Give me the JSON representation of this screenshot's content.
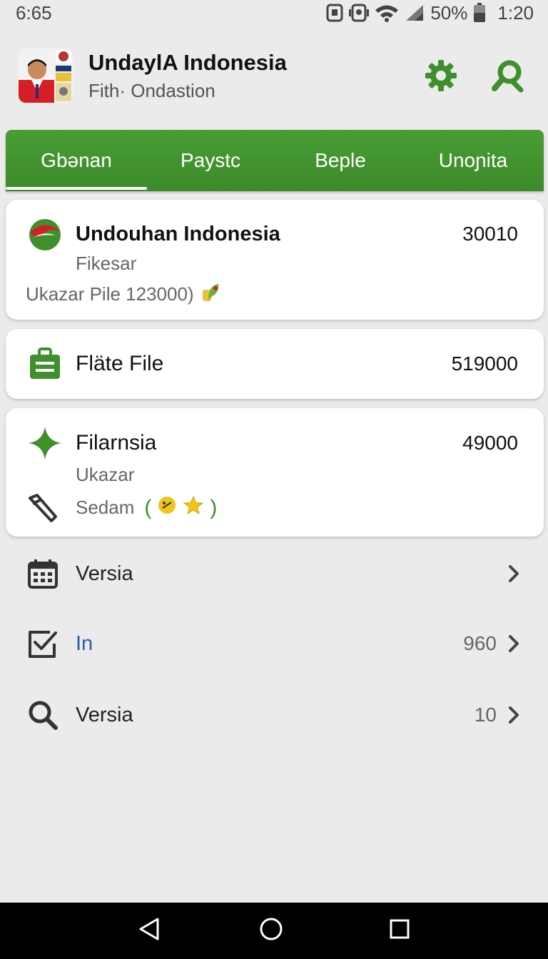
{
  "status_bar": {
    "left_time": "6:65",
    "battery": "50%",
    "clock": "1:20"
  },
  "header": {
    "title": "UndaylA Indonesia",
    "subtitle": "Fith· Ondastion",
    "icons": [
      "settings-gear-icon",
      "search-icon"
    ]
  },
  "tabs": [
    {
      "label": "Gbənan",
      "active": true
    },
    {
      "label": "Paystc",
      "active": false
    },
    {
      "label": "Beple",
      "active": false
    },
    {
      "label": "Unoɲita",
      "active": false
    }
  ],
  "cards": [
    {
      "icon": "red-green-logo-icon",
      "title": "Undouhan Indonesia",
      "value": "30010",
      "subtitle": "Fikesar",
      "line": "Ukazar Pile 123000)"
    },
    {
      "icon": "briefcase-icon",
      "title": "Fläte File",
      "value": "519000"
    },
    {
      "icon": "sparkle-star-icon",
      "title": "Filarnsia",
      "value": "49000",
      "subtitle": "Ukazar",
      "line": "Sedam",
      "line_paren_open": "(",
      "line_paren_close": ")"
    }
  ],
  "list": [
    {
      "icon": "calendar-icon",
      "label": "Versia",
      "value": ""
    },
    {
      "icon": "checklist-icon",
      "label": "In",
      "value": "960"
    },
    {
      "icon": "search-icon",
      "label": "Versia",
      "value": "10"
    }
  ],
  "colors": {
    "accent_green": "#3f8f2c",
    "link_blue": "#2a5caa",
    "background": "#ebebeb"
  }
}
